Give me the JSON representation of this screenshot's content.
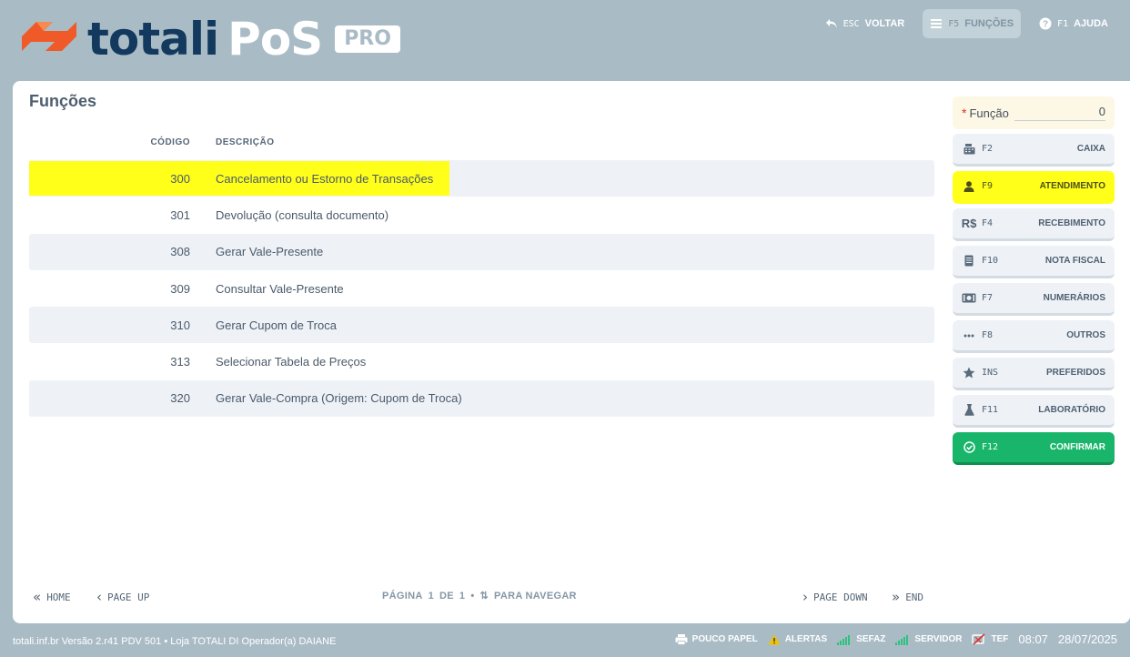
{
  "header": {
    "logo_text": "totali",
    "logo_pos": "PoS",
    "logo_badge": "PRO",
    "actions": [
      {
        "key": "ESC",
        "label": "VOLTAR",
        "icon": "undo-icon"
      },
      {
        "key": "F5",
        "label": "FUNÇÕES",
        "icon": "menu-icon"
      },
      {
        "key": "F1",
        "label": "AJUDA",
        "icon": "help-icon"
      }
    ]
  },
  "main": {
    "title": "Funções",
    "columns": {
      "code": "CÓDIGO",
      "desc": "DESCRIÇÃO"
    },
    "rows": [
      {
        "code": "300",
        "desc": "Cancelamento ou Estorno de Transações"
      },
      {
        "code": "301",
        "desc": "Devolução (consulta documento)"
      },
      {
        "code": "308",
        "desc": "Gerar Vale-Presente"
      },
      {
        "code": "309",
        "desc": "Consultar Vale-Presente"
      },
      {
        "code": "310",
        "desc": "Gerar Cupom de Troca"
      },
      {
        "code": "313",
        "desc": "Selecionar Tabela de Preços"
      },
      {
        "code": "320",
        "desc": "Gerar Vale-Compra (Origem: Cupom de Troca)"
      }
    ],
    "pager": {
      "home": "HOME",
      "page_up": "PAGE UP",
      "page_word": "PÁGINA",
      "page_current": "1",
      "of_word": "DE",
      "page_total": "1",
      "navigate": "PARA NAVEGAR",
      "page_down": "PAGE DOWN",
      "end": "END"
    }
  },
  "panel": {
    "funcao_label": "Função",
    "funcao_value": "0",
    "buttons": [
      {
        "key": "F2",
        "label": "CAIXA",
        "icon": "register-icon"
      },
      {
        "key": "F9",
        "label": "ATENDIMENTO",
        "icon": "user-icon"
      },
      {
        "key": "F4",
        "label": "RECEBIMENTO",
        "icon": "R$"
      },
      {
        "key": "F10",
        "label": "NOTA FISCAL",
        "icon": "document-icon"
      },
      {
        "key": "F7",
        "label": "NUMERÁRIOS",
        "icon": "money-icon"
      },
      {
        "key": "F8",
        "label": "OUTROS",
        "icon": "dots-icon"
      },
      {
        "key": "INS",
        "label": "PREFERIDOS",
        "icon": "star-icon"
      },
      {
        "key": "F11",
        "label": "LABORATÓRIO",
        "icon": "flask-icon"
      },
      {
        "key": "F12",
        "label": "CONFIRMAR",
        "icon": "check-circle-icon"
      }
    ]
  },
  "footer": {
    "info": "totali.inf.br Versão 2.r41 PDV 501  •  Loja TOTALI DI Operador(a) DAIANE",
    "status": [
      {
        "label": "POUCO PAPEL",
        "icon": "printer-icon"
      },
      {
        "label": "ALERTAS",
        "icon": "warning-icon"
      },
      {
        "label": "SEFAZ",
        "icon": "signal-icon"
      },
      {
        "label": "SERVIDOR",
        "icon": "signal-icon"
      },
      {
        "label": "TEF",
        "icon": "tef-off-icon"
      }
    ],
    "time": "08:07",
    "date": "28/07/2025"
  },
  "colors": {
    "background": "#a9bcc6",
    "brand_dark": "#133a5e",
    "brand_orange": "#f05a28",
    "highlight": "#ffff1a",
    "confirm": "#18b56a"
  }
}
